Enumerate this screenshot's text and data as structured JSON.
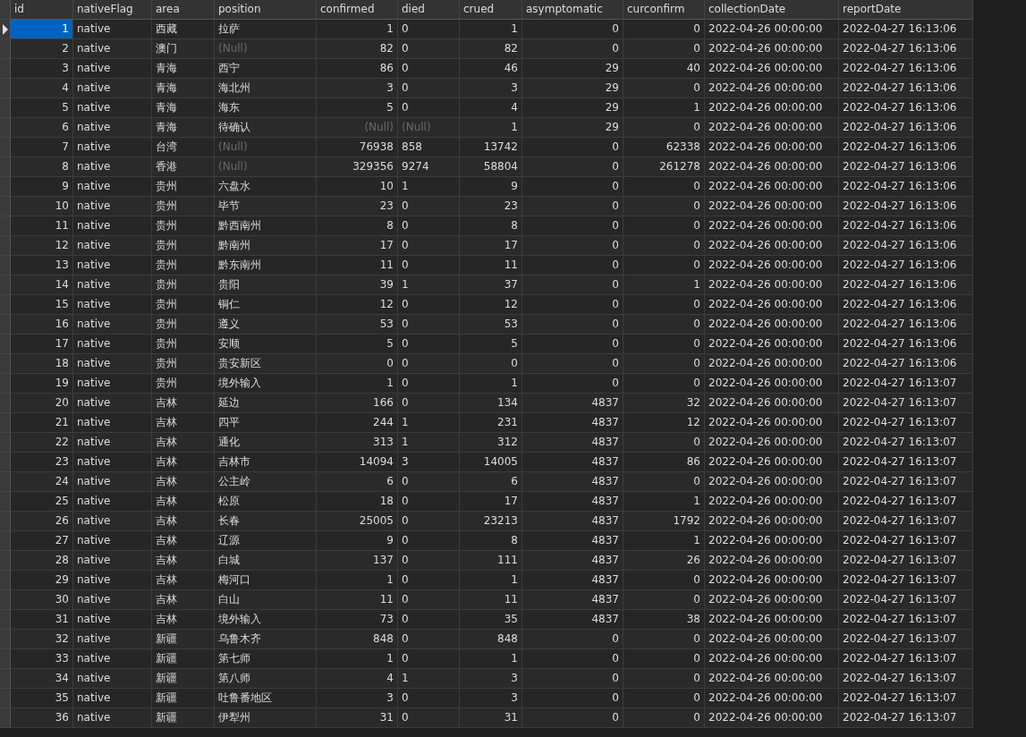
{
  "table": {
    "columns": [
      "id",
      "nativeFlag",
      "area",
      "position",
      "confirmed",
      "died",
      "crued",
      "asymptomatic",
      "curconfirm",
      "collectionDate",
      "reportDate"
    ],
    "rows": [
      {
        "selected": true,
        "cells": [
          "1",
          "native",
          "西藏",
          "拉萨",
          "1",
          "0",
          "1",
          "0",
          "0",
          "2022-04-26 00:00:00",
          "2022-04-27 16:13:06"
        ]
      },
      {
        "selected": false,
        "cells": [
          "2",
          "native",
          "澳门",
          {
            "text": "(Null)",
            "kind": "null"
          },
          "82",
          "0",
          "82",
          "0",
          "0",
          "2022-04-26 00:00:00",
          "2022-04-27 16:13:06"
        ]
      },
      {
        "selected": false,
        "cells": [
          "3",
          "native",
          "青海",
          "西宁",
          "86",
          "0",
          "46",
          "29",
          "40",
          "2022-04-26 00:00:00",
          "2022-04-27 16:13:06"
        ]
      },
      {
        "selected": false,
        "cells": [
          "4",
          "native",
          "青海",
          "海北州",
          "3",
          "0",
          "3",
          "29",
          "0",
          "2022-04-26 00:00:00",
          "2022-04-27 16:13:06"
        ]
      },
      {
        "selected": false,
        "cells": [
          "5",
          "native",
          "青海",
          "海东",
          "5",
          "0",
          "4",
          "29",
          "1",
          "2022-04-26 00:00:00",
          "2022-04-27 16:13:06"
        ]
      },
      {
        "selected": false,
        "cells": [
          "6",
          "native",
          "青海",
          "待确认",
          {
            "text": "(Null)",
            "kind": "null"
          },
          {
            "text": "(Null)",
            "kind": "null"
          },
          "1",
          "29",
          "0",
          "2022-04-26 00:00:00",
          "2022-04-27 16:13:06"
        ]
      },
      {
        "selected": false,
        "cells": [
          "7",
          "native",
          "台湾",
          {
            "text": "(Null)",
            "kind": "null"
          },
          "76938",
          "858",
          "13742",
          "0",
          "62338",
          "2022-04-26 00:00:00",
          "2022-04-27 16:13:06"
        ]
      },
      {
        "selected": false,
        "cells": [
          "8",
          "native",
          "香港",
          {
            "text": "(Null)",
            "kind": "null"
          },
          "329356",
          "9274",
          "58804",
          "0",
          "261278",
          "2022-04-26 00:00:00",
          "2022-04-27 16:13:06"
        ]
      },
      {
        "selected": false,
        "cells": [
          "9",
          "native",
          "贵州",
          "六盘水",
          "10",
          "1",
          "9",
          "0",
          "0",
          "2022-04-26 00:00:00",
          "2022-04-27 16:13:06"
        ]
      },
      {
        "selected": false,
        "cells": [
          "10",
          "native",
          "贵州",
          "毕节",
          "23",
          "0",
          "23",
          "0",
          "0",
          "2022-04-26 00:00:00",
          "2022-04-27 16:13:06"
        ]
      },
      {
        "selected": false,
        "cells": [
          "11",
          "native",
          "贵州",
          "黔西南州",
          "8",
          "0",
          "8",
          "0",
          "0",
          "2022-04-26 00:00:00",
          "2022-04-27 16:13:06"
        ]
      },
      {
        "selected": false,
        "cells": [
          "12",
          "native",
          "贵州",
          "黔南州",
          "17",
          "0",
          "17",
          "0",
          "0",
          "2022-04-26 00:00:00",
          "2022-04-27 16:13:06"
        ]
      },
      {
        "selected": false,
        "cells": [
          "13",
          "native",
          "贵州",
          "黔东南州",
          "11",
          "0",
          "11",
          "0",
          "0",
          "2022-04-26 00:00:00",
          "2022-04-27 16:13:06"
        ]
      },
      {
        "selected": false,
        "cells": [
          "14",
          "native",
          "贵州",
          "贵阳",
          "39",
          "1",
          "37",
          "0",
          "1",
          "2022-04-26 00:00:00",
          "2022-04-27 16:13:06"
        ]
      },
      {
        "selected": false,
        "cells": [
          "15",
          "native",
          "贵州",
          "铜仁",
          "12",
          "0",
          "12",
          "0",
          "0",
          "2022-04-26 00:00:00",
          "2022-04-27 16:13:06"
        ]
      },
      {
        "selected": false,
        "cells": [
          "16",
          "native",
          "贵州",
          "遵义",
          "53",
          "0",
          "53",
          "0",
          "0",
          "2022-04-26 00:00:00",
          "2022-04-27 16:13:06"
        ]
      },
      {
        "selected": false,
        "cells": [
          "17",
          "native",
          "贵州",
          "安顺",
          "5",
          "0",
          "5",
          "0",
          "0",
          "2022-04-26 00:00:00",
          "2022-04-27 16:13:06"
        ]
      },
      {
        "selected": false,
        "cells": [
          "18",
          "native",
          "贵州",
          "贵安新区",
          "0",
          "0",
          "0",
          "0",
          "0",
          "2022-04-26 00:00:00",
          "2022-04-27 16:13:06"
        ]
      },
      {
        "selected": false,
        "cells": [
          "19",
          "native",
          "贵州",
          "境外输入",
          "1",
          "0",
          "1",
          "0",
          "0",
          "2022-04-26 00:00:00",
          "2022-04-27 16:13:07"
        ]
      },
      {
        "selected": false,
        "cells": [
          "20",
          "native",
          "吉林",
          "延边",
          "166",
          "0",
          "134",
          "4837",
          "32",
          "2022-04-26 00:00:00",
          "2022-04-27 16:13:07"
        ]
      },
      {
        "selected": false,
        "cells": [
          "21",
          "native",
          "吉林",
          "四平",
          "244",
          "1",
          "231",
          "4837",
          "12",
          "2022-04-26 00:00:00",
          "2022-04-27 16:13:07"
        ]
      },
      {
        "selected": false,
        "cells": [
          "22",
          "native",
          "吉林",
          "通化",
          "313",
          "1",
          "312",
          "4837",
          "0",
          "2022-04-26 00:00:00",
          "2022-04-27 16:13:07"
        ]
      },
      {
        "selected": false,
        "cells": [
          "23",
          "native",
          "吉林",
          "吉林市",
          "14094",
          "3",
          "14005",
          "4837",
          "86",
          "2022-04-26 00:00:00",
          "2022-04-27 16:13:07"
        ]
      },
      {
        "selected": false,
        "cells": [
          "24",
          "native",
          "吉林",
          "公主岭",
          "6",
          "0",
          "6",
          "4837",
          "0",
          "2022-04-26 00:00:00",
          "2022-04-27 16:13:07"
        ]
      },
      {
        "selected": false,
        "cells": [
          "25",
          "native",
          "吉林",
          "松原",
          "18",
          "0",
          "17",
          "4837",
          "1",
          "2022-04-26 00:00:00",
          "2022-04-27 16:13:07"
        ]
      },
      {
        "selected": false,
        "cells": [
          "26",
          "native",
          "吉林",
          "长春",
          "25005",
          "0",
          "23213",
          "4837",
          "1792",
          "2022-04-26 00:00:00",
          "2022-04-27 16:13:07"
        ]
      },
      {
        "selected": false,
        "cells": [
          "27",
          "native",
          "吉林",
          "辽源",
          "9",
          "0",
          "8",
          "4837",
          "1",
          "2022-04-26 00:00:00",
          "2022-04-27 16:13:07"
        ]
      },
      {
        "selected": false,
        "cells": [
          "28",
          "native",
          "吉林",
          "白城",
          "137",
          "0",
          "111",
          "4837",
          "26",
          "2022-04-26 00:00:00",
          "2022-04-27 16:13:07"
        ]
      },
      {
        "selected": false,
        "cells": [
          "29",
          "native",
          "吉林",
          "梅河口",
          "1",
          "0",
          "1",
          "4837",
          "0",
          "2022-04-26 00:00:00",
          "2022-04-27 16:13:07"
        ]
      },
      {
        "selected": false,
        "cells": [
          "30",
          "native",
          "吉林",
          "白山",
          "11",
          "0",
          "11",
          "4837",
          "0",
          "2022-04-26 00:00:00",
          "2022-04-27 16:13:07"
        ]
      },
      {
        "selected": false,
        "cells": [
          "31",
          "native",
          "吉林",
          "境外输入",
          "73",
          "0",
          "35",
          "4837",
          "38",
          "2022-04-26 00:00:00",
          "2022-04-27 16:13:07"
        ]
      },
      {
        "selected": false,
        "cells": [
          "32",
          "native",
          "新疆",
          "乌鲁木齐",
          "848",
          "0",
          "848",
          "0",
          "0",
          "2022-04-26 00:00:00",
          "2022-04-27 16:13:07"
        ]
      },
      {
        "selected": false,
        "cells": [
          "33",
          "native",
          "新疆",
          "第七师",
          "1",
          "0",
          "1",
          "0",
          "0",
          "2022-04-26 00:00:00",
          "2022-04-27 16:13:07"
        ]
      },
      {
        "selected": false,
        "cells": [
          "34",
          "native",
          "新疆",
          "第八师",
          "4",
          "1",
          "3",
          "0",
          "0",
          "2022-04-26 00:00:00",
          "2022-04-27 16:13:07"
        ]
      },
      {
        "selected": false,
        "cells": [
          "35",
          "native",
          "新疆",
          "吐鲁番地区",
          "3",
          "0",
          "3",
          "0",
          "0",
          "2022-04-26 00:00:00",
          "2022-04-27 16:13:07"
        ]
      },
      {
        "selected": false,
        "cells": [
          "36",
          "native",
          "新疆",
          "伊犁州",
          "31",
          "0",
          "31",
          "0",
          "0",
          "2022-04-26 00:00:00",
          "2022-04-27 16:13:07"
        ]
      }
    ]
  }
}
